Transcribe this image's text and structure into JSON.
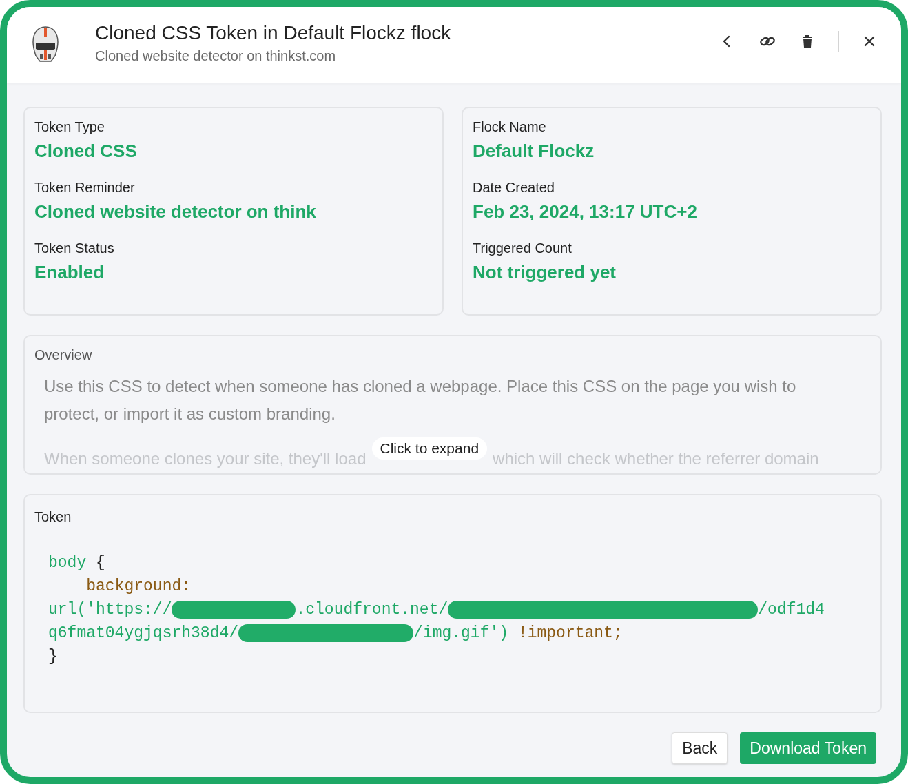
{
  "header": {
    "title": "Cloned CSS Token in Default Flockz flock",
    "subtitle": "Cloned website detector on thinkst.com",
    "actions": [
      {
        "kind": "back"
      },
      {
        "kind": "link"
      },
      {
        "kind": "delete"
      },
      {
        "kind": "close"
      }
    ]
  },
  "details": [
    [
      {
        "label": "Token Type",
        "value": "Cloned CSS"
      },
      {
        "label": "Token Reminder",
        "value": "Cloned website detector on think"
      },
      {
        "label": "Token Status",
        "value": "Enabled"
      }
    ],
    [
      {
        "label": "Flock Name",
        "value": "Default Flockz"
      },
      {
        "label": "Date Created",
        "value": "Feb 23, 2024, 13:17 UTC+2"
      },
      {
        "label": "Triggered Count",
        "value": "Not triggered yet"
      }
    ]
  ],
  "overview": {
    "label": "Overview",
    "paragraph": "Use this CSS to detect when someone has cloned a webpage. Place this CSS on the page you wish to protect, or import it as custom branding.",
    "faded_before": "When someone clones your site, they'll load",
    "expand": "Click to expand",
    "faded_after": "which will check whether the referrer domain"
  },
  "token": {
    "label": "Token",
    "lines": [
      [
        {
          "kind": "selector",
          "text": "body"
        },
        {
          "kind": "punct",
          "text": " {"
        }
      ],
      [
        {
          "kind": "property",
          "text": "    background:"
        }
      ],
      [
        {
          "kind": "string",
          "text": "url('https://"
        },
        {
          "kind": "shortredaction"
        },
        {
          "kind": "string",
          "text": ".cloudfront.net/"
        },
        {
          "kind": "longredaction"
        },
        {
          "kind": "string",
          "text": "/odf1d4"
        }
      ],
      [
        {
          "kind": "string",
          "text": "q6fmat04ygjqsrh38d4/"
        },
        {
          "kind": "midredaction"
        },
        {
          "kind": "string",
          "text": "/img.gif')"
        },
        {
          "kind": "property",
          "text": " !important;"
        }
      ],
      [
        {
          "kind": "punct",
          "text": "}"
        }
      ]
    ]
  },
  "buttons": [
    {
      "kind": "secondary",
      "label": "Back"
    },
    {
      "kind": "primary",
      "label": "Download Token"
    }
  ]
}
